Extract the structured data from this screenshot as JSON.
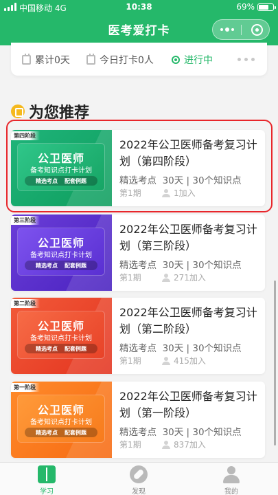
{
  "status_bar": {
    "carrier": "中国移动",
    "network": "4G",
    "time": "10:38",
    "battery": "69%"
  },
  "nav": {
    "title": "医考爱打卡"
  },
  "stats": {
    "total": "累计0天",
    "today": "今日打卡0人",
    "status": "进行中"
  },
  "section": {
    "title": "为您推荐"
  },
  "courses": [
    {
      "stage": "第四阶段",
      "cover_title": "公卫医师",
      "cover_subtitle": "备考知识点打卡计划",
      "cover_tag1": "精选考点",
      "cover_tag2": "配套例题",
      "title": "2022年公卫医师备考复习计划（第四阶段）",
      "meta": "精选考点  30天 | 30个知识点",
      "period": "第1期",
      "joined": "1加入"
    },
    {
      "stage": "第三阶段",
      "cover_title": "公卫医师",
      "cover_subtitle": "备考知识点打卡计划",
      "cover_tag1": "精选考点",
      "cover_tag2": "配套例题",
      "title": "2022年公卫医师备考复习计划（第三阶段）",
      "meta": "精选考点  30天 | 30个知识点",
      "period": "第1期",
      "joined": "271加入"
    },
    {
      "stage": "第二阶段",
      "cover_title": "公卫医师",
      "cover_subtitle": "备考知识点打卡计划",
      "cover_tag1": "精选考点",
      "cover_tag2": "配套例题",
      "title": "2022年公卫医师备考复习计划（第二阶段）",
      "meta": "精选考点  30天 | 30个知识点",
      "period": "第1期",
      "joined": "415加入"
    },
    {
      "stage": "第一阶段",
      "cover_title": "公卫医师",
      "cover_subtitle": "备考知识点打卡计划",
      "cover_tag1": "精选考点",
      "cover_tag2": "配套例题",
      "title": "2022年公卫医师备考复习计划（第一阶段）",
      "meta": "精选考点  30天 | 30个知识点",
      "period": "第1期",
      "joined": "837加入"
    }
  ],
  "tabs": [
    {
      "label": "学习",
      "active": true
    },
    {
      "label": "发现",
      "active": false
    },
    {
      "label": "我的",
      "active": false
    }
  ],
  "colors": {
    "brand": "#25b86a",
    "highlight": "#e8262b"
  }
}
